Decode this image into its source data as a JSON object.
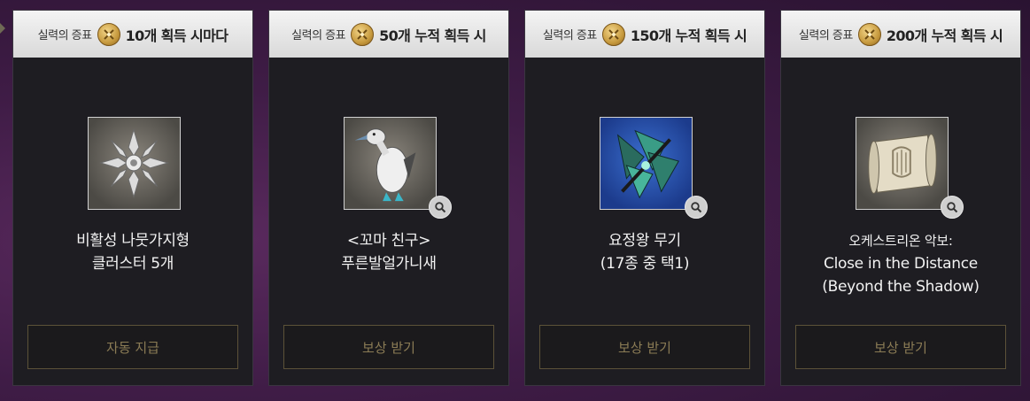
{
  "cards": [
    {
      "header_prefix": "실력의 증표",
      "header_suffix": "10개 획득 시마다",
      "medal_icon": "crossed-swords-medal-icon",
      "item_icon": "silver-branch-cluster-icon",
      "name_lines": [
        "비활성 나뭇가지형",
        "클러스터 5개"
      ],
      "has_zoom": false,
      "button_label": "자동 지급"
    },
    {
      "header_prefix": "실력의 증표",
      "header_suffix": "50개 누적 획득 시",
      "medal_icon": "crossed-swords-medal-icon",
      "item_icon": "blue-footed-booby-icon",
      "name_lines": [
        "<꼬마 친구>",
        "푸른발얼가니새"
      ],
      "has_zoom": true,
      "button_label": "보상 받기"
    },
    {
      "header_prefix": "실력의 증표",
      "header_suffix": "150개 누적 획득 시",
      "medal_icon": "crossed-swords-medal-icon",
      "item_icon": "fairy-king-weapon-icon",
      "name_lines": [
        "요정왕 무기",
        "(17종 중 택1)"
      ],
      "has_zoom": true,
      "button_label": "보상 받기"
    },
    {
      "header_prefix": "실력의 증표",
      "header_suffix": "200개 누적 획득 시",
      "medal_icon": "crossed-swords-medal-icon",
      "item_icon": "music-scroll-icon",
      "name_lines": [
        "오케스트리온 악보:",
        "Close in the Distance",
        "(Beyond the Shadow)"
      ],
      "has_zoom": true,
      "button_label": "보상 받기"
    }
  ],
  "colors": {
    "card_bg": "#1e1d22",
    "header_bg": "#e8e8e8",
    "button_text": "#8b7c55",
    "button_border": "#5c5238"
  }
}
